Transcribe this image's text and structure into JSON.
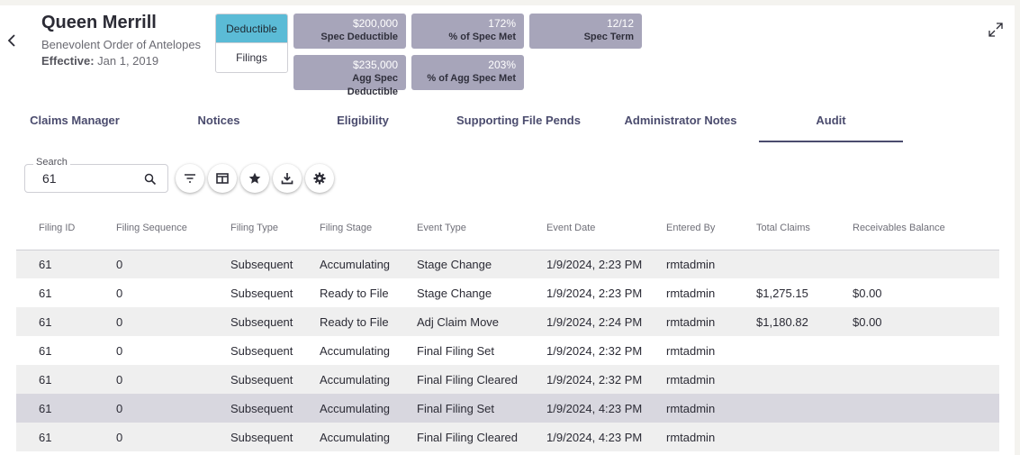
{
  "header": {
    "title": "Queen Merrill",
    "subtitle": "Benevolent Order of Antelopes",
    "effective_label": "Effective:",
    "effective_value": "Jan 1, 2019"
  },
  "toggle": {
    "active_label": "Deductible",
    "inactive_label": "Filings"
  },
  "stats": {
    "spec_deductible": {
      "value": "$200,000",
      "label": "Spec Deductible"
    },
    "pct_spec_met": {
      "value": "172%",
      "label": "% of Spec Met"
    },
    "spec_term": {
      "value": "12/12",
      "label": "Spec Term"
    },
    "agg_spec_deductible": {
      "value": "$235,000",
      "label": "Agg Spec Deductible"
    },
    "pct_agg_spec_met": {
      "value": "203%",
      "label": "% of Agg Spec Met"
    }
  },
  "tabs": [
    {
      "label": "Claims Manager"
    },
    {
      "label": "Notices"
    },
    {
      "label": "Eligibility"
    },
    {
      "label": "Supporting File Pends"
    },
    {
      "label": "Administrator Notes"
    },
    {
      "label": "Audit"
    }
  ],
  "search": {
    "label": "Search",
    "value": "61"
  },
  "table": {
    "columns": [
      "Filing ID",
      "Filing Sequence",
      "Filing Type",
      "Filing Stage",
      "Event Type",
      "Event Date",
      "Entered By",
      "Total Claims",
      "Receivables Balance"
    ],
    "rows": [
      [
        "61",
        "0",
        "Subsequent",
        "Accumulating",
        "Stage Change",
        "1/9/2024, 2:23 PM",
        "rmtadmin",
        "",
        ""
      ],
      [
        "61",
        "0",
        "Subsequent",
        "Ready to File",
        "Stage Change",
        "1/9/2024, 2:23 PM",
        "rmtadmin",
        "$1,275.15",
        "$0.00"
      ],
      [
        "61",
        "0",
        "Subsequent",
        "Ready to File",
        "Adj Claim Move",
        "1/9/2024, 2:24 PM",
        "rmtadmin",
        "$1,180.82",
        "$0.00"
      ],
      [
        "61",
        "0",
        "Subsequent",
        "Accumulating",
        "Final Filing Set",
        "1/9/2024, 2:32 PM",
        "rmtadmin",
        "",
        ""
      ],
      [
        "61",
        "0",
        "Subsequent",
        "Accumulating",
        "Final Filing Cleared",
        "1/9/2024, 2:32 PM",
        "rmtadmin",
        "",
        ""
      ],
      [
        "61",
        "0",
        "Subsequent",
        "Accumulating",
        "Final Filing Set",
        "1/9/2024, 4:23 PM",
        "rmtadmin",
        "",
        ""
      ],
      [
        "61",
        "0",
        "Subsequent",
        "Accumulating",
        "Final Filing Cleared",
        "1/9/2024, 4:23 PM",
        "rmtadmin",
        "",
        ""
      ]
    ],
    "highlighted_row": 5
  },
  "colors": {
    "accent_toggle": "#5bbbd6",
    "stat_bg": "#a7a5ba",
    "tab_text": "#4b4c6e",
    "row_stripe": "#efefef",
    "row_highlight": "#d8d7df"
  },
  "icons": [
    "chevron-left-icon",
    "expand-icon",
    "search-icon",
    "filter-icon",
    "columns-icon",
    "star-icon",
    "download-icon",
    "gear-icon"
  ]
}
